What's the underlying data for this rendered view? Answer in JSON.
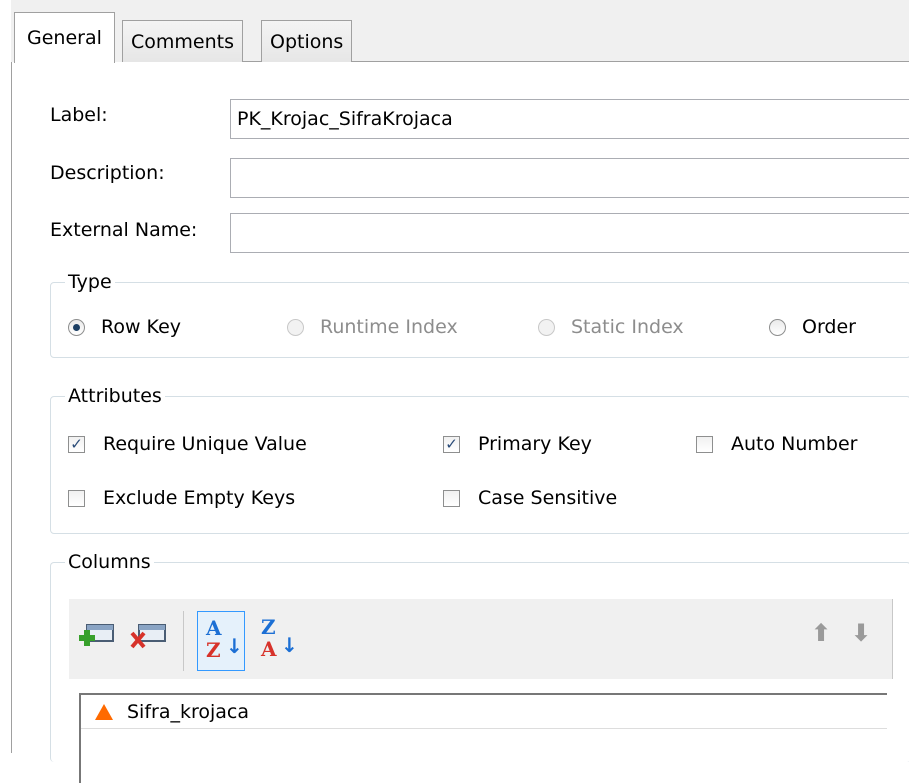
{
  "tabs": [
    {
      "label": "General",
      "active": true
    },
    {
      "label": "Comments",
      "active": false
    },
    {
      "label": "Options",
      "active": false
    }
  ],
  "fields": {
    "label": {
      "caption": "Label:",
      "value": "PK_Krojac_SifraKrojaca"
    },
    "description": {
      "caption": "Description:",
      "value": ""
    },
    "external_name": {
      "caption": "External Name:",
      "value": ""
    }
  },
  "type_group": {
    "title": "Type",
    "options": [
      {
        "label": "Row Key",
        "selected": true,
        "enabled": true
      },
      {
        "label": "Runtime Index",
        "selected": false,
        "enabled": false
      },
      {
        "label": "Static Index",
        "selected": false,
        "enabled": false
      },
      {
        "label": "Order",
        "selected": false,
        "enabled": true
      }
    ]
  },
  "attributes_group": {
    "title": "Attributes",
    "checkboxes": [
      {
        "label": "Require Unique Value",
        "checked": true
      },
      {
        "label": "Primary Key",
        "checked": true
      },
      {
        "label": "Auto Number",
        "checked": false
      },
      {
        "label": "Exclude Empty Keys",
        "checked": false
      },
      {
        "label": "Case Sensitive",
        "checked": false
      }
    ]
  },
  "columns_group": {
    "title": "Columns",
    "toolbar": {
      "add_icon": "add-column-icon",
      "remove_icon": "remove-column-icon",
      "sort_asc_icon": "sort-ascending-icon",
      "sort_desc_icon": "sort-descending-icon",
      "move_up_icon": "arrow-up-icon",
      "move_down_icon": "arrow-down-icon",
      "sort_asc_top": "A",
      "sort_asc_bottom": "Z",
      "sort_desc_top": "Z",
      "sort_desc_bottom": "A"
    },
    "rows": [
      {
        "name": "Sifra_krojaca",
        "icon": "warning-triangle-icon"
      }
    ]
  },
  "colors": {
    "accent_blue": "#3399ff",
    "warning_orange": "#ff6a00",
    "check_mark": "#2a4b78"
  }
}
